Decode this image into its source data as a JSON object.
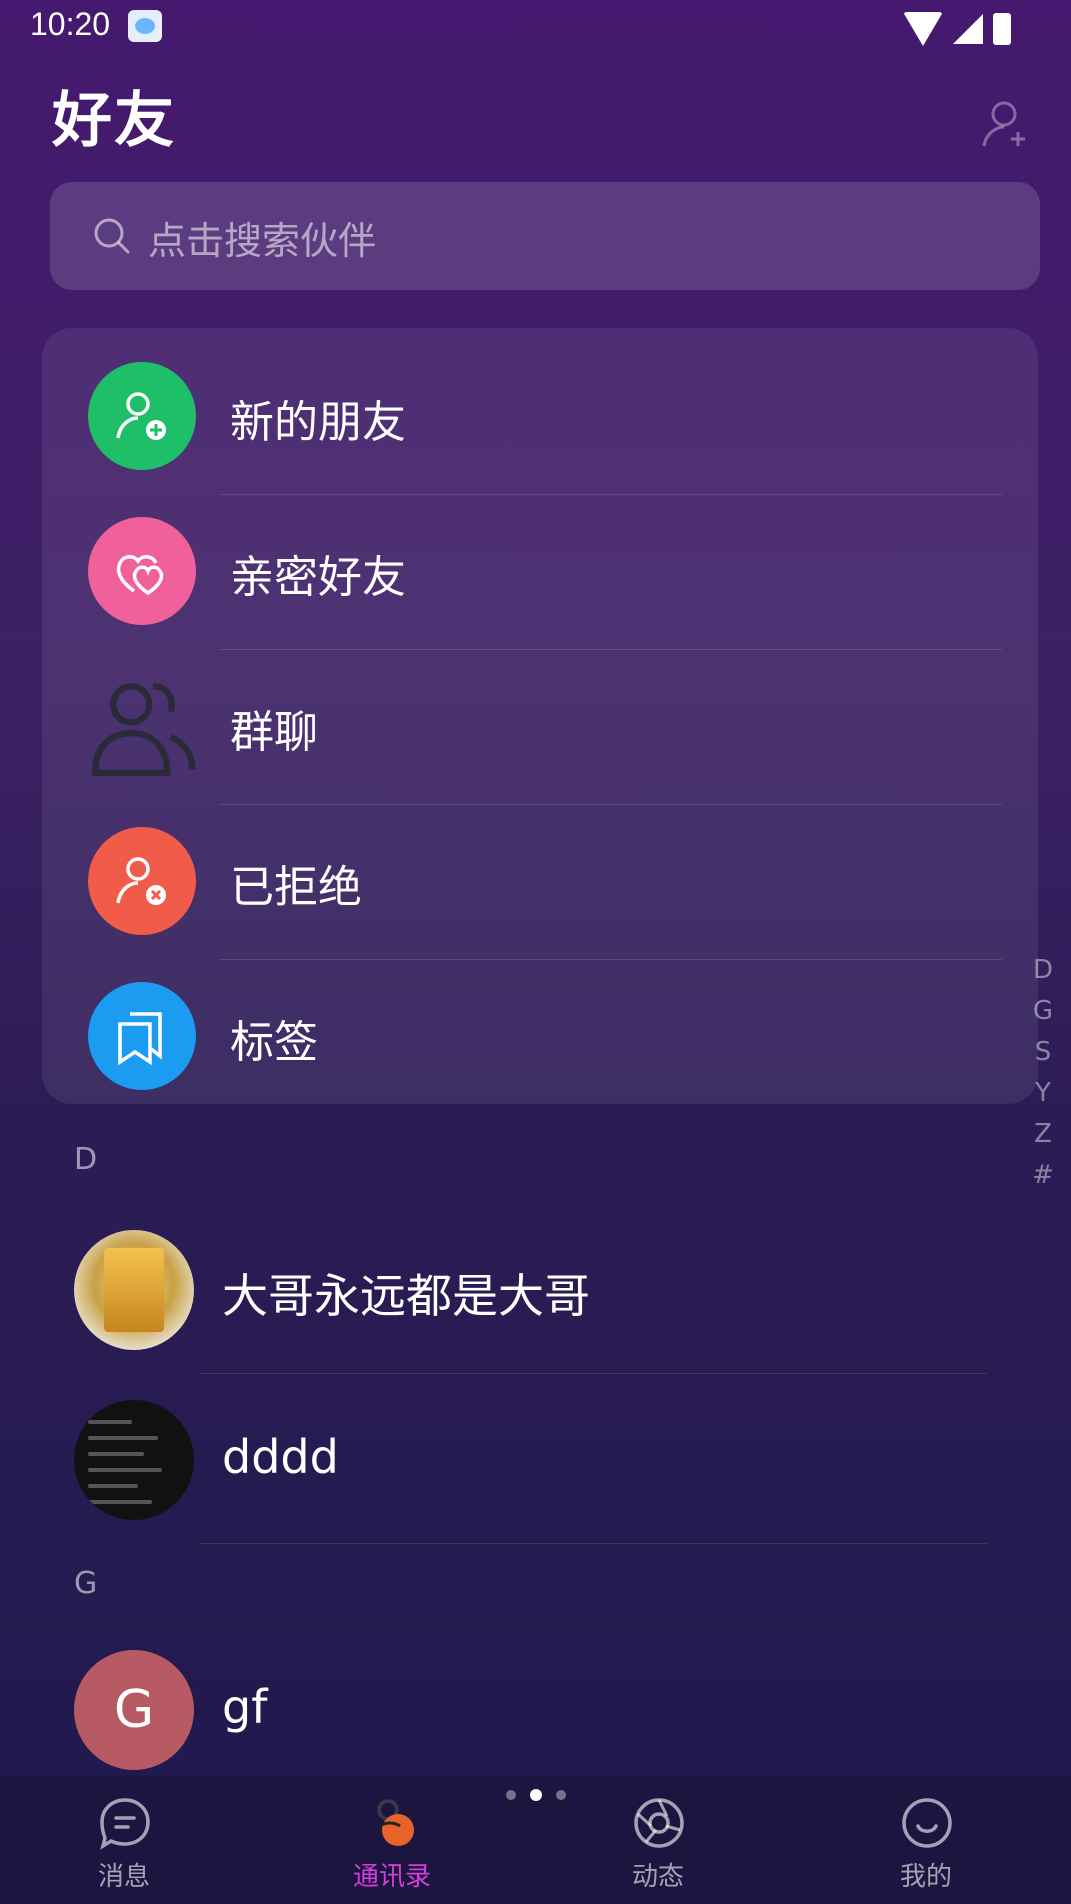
{
  "status_bar": {
    "time": "10:20"
  },
  "header": {
    "title": "好友"
  },
  "search": {
    "placeholder": "点击搜索伙伴"
  },
  "menu": {
    "items": [
      {
        "label": "新的朋友",
        "icon": "add-user-icon",
        "color": "#1fbf6a"
      },
      {
        "label": "亲密好友",
        "icon": "heart-icon",
        "color": "#f0609a"
      },
      {
        "label": "群聊",
        "icon": "group-icon",
        "color": "transparent"
      },
      {
        "label": "已拒绝",
        "icon": "rejected-user-icon",
        "color": "#f05b4a"
      },
      {
        "label": "标签",
        "icon": "tag-icon",
        "color": "#1c9cf0"
      }
    ]
  },
  "index_letters": [
    "D",
    "G",
    "S",
    "Y",
    "Z",
    "#"
  ],
  "sections": [
    {
      "letter": "D",
      "contacts": [
        {
          "name": "大哥永远都是大哥"
        },
        {
          "name": "dddd"
        }
      ]
    },
    {
      "letter": "G",
      "contacts": [
        {
          "name": "gf",
          "initial": "G"
        }
      ]
    }
  ],
  "bottom_nav": {
    "items": [
      {
        "label": "消息",
        "icon": "message-icon",
        "active": false
      },
      {
        "label": "通讯录",
        "icon": "contacts-icon",
        "active": true
      },
      {
        "label": "动态",
        "icon": "moments-icon",
        "active": false
      },
      {
        "label": "我的",
        "icon": "profile-icon",
        "active": false
      }
    ]
  },
  "colors": {
    "accent": "#d23fd9",
    "nav_bg": "#1c1540"
  }
}
